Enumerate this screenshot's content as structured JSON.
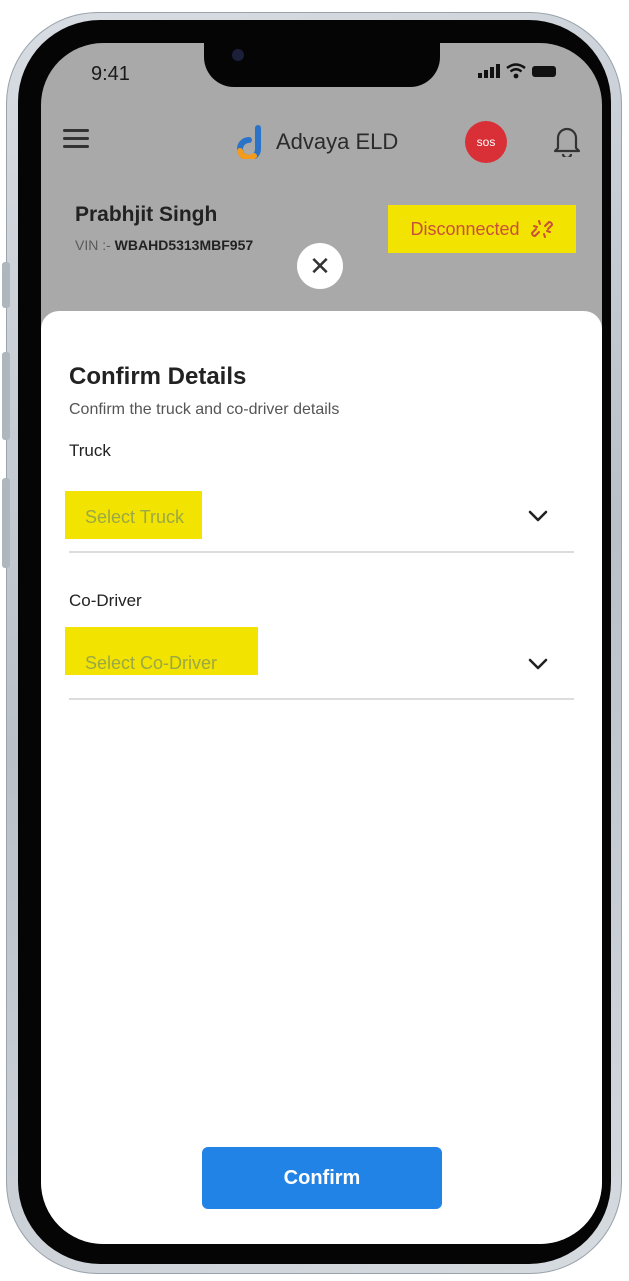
{
  "status_bar": {
    "time": "9:41"
  },
  "header": {
    "brand_name": "Advaya ELD",
    "sos_label": "sos"
  },
  "driver": {
    "name": "Prabhjit Singh",
    "vin_label": "VIN :-",
    "vin_value": "WBAHD5313MBF957",
    "connection_status": "Disconnected"
  },
  "modal": {
    "close_glyph": "✕",
    "title": "Confirm Details",
    "subtitle": "Confirm the truck and co-driver details",
    "truck": {
      "label": "Truck",
      "placeholder": "Select Truck"
    },
    "co_driver": {
      "label": "Co-Driver",
      "placeholder": "Select Co-Driver"
    },
    "confirm_label": "Confirm"
  },
  "colors": {
    "highlight": "#f2e300",
    "sos": "#d92f37",
    "confirm": "#2283e6",
    "disconnected_text": "#c8503a",
    "overlay": "#a9a9a9"
  },
  "icons": {
    "menu": "hamburger-icon",
    "brand": "advaya-logo-icon",
    "notifications": "bell-icon",
    "disconnect": "broken-link-icon",
    "close": "close-icon",
    "dropdown": "chevron-down-icon"
  }
}
